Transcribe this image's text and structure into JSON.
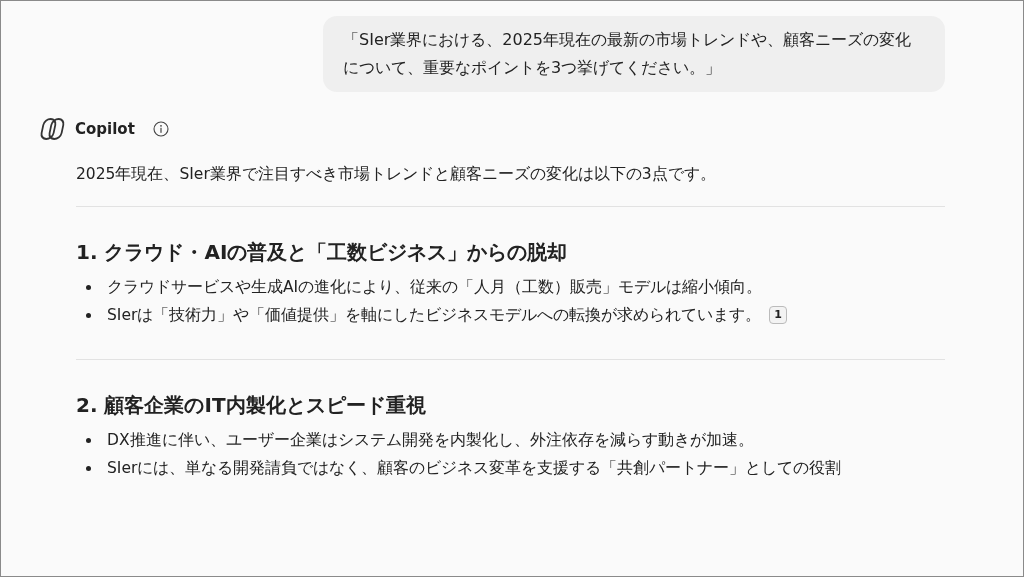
{
  "user_message": "「SIer業界における、2025年現在の最新の市場トレンドや、顧客ニーズの変化について、重要なポイントを3つ挙げてください。」",
  "assistant": {
    "name": "Copilot",
    "intro": "2025年現在、SIer業界で注目すべき市場トレンドと顧客ニーズの変化は以下の3点です。",
    "sections": [
      {
        "heading": "1. クラウド・AIの普及と「工数ビジネス」からの脱却",
        "bullets": [
          {
            "text": "クラウドサービスや生成AIの進化により、従来の「人月（工数）販売」モデルは縮小傾向。"
          },
          {
            "text": "SIerは「技術力」や「価値提供」を軸にしたビジネスモデルへの転換が求められています。",
            "citation": "1"
          }
        ]
      },
      {
        "heading": "2. 顧客企業のIT内製化とスピード重視",
        "bullets": [
          {
            "text": "DX推進に伴い、ユーザー企業はシステム開発を内製化し、外注依存を減らす動きが加速。"
          },
          {
            "text": "SIerには、単なる開発請負ではなく、顧客のビジネス変革を支援する「共創パートナー」としての役割"
          }
        ]
      }
    ]
  }
}
